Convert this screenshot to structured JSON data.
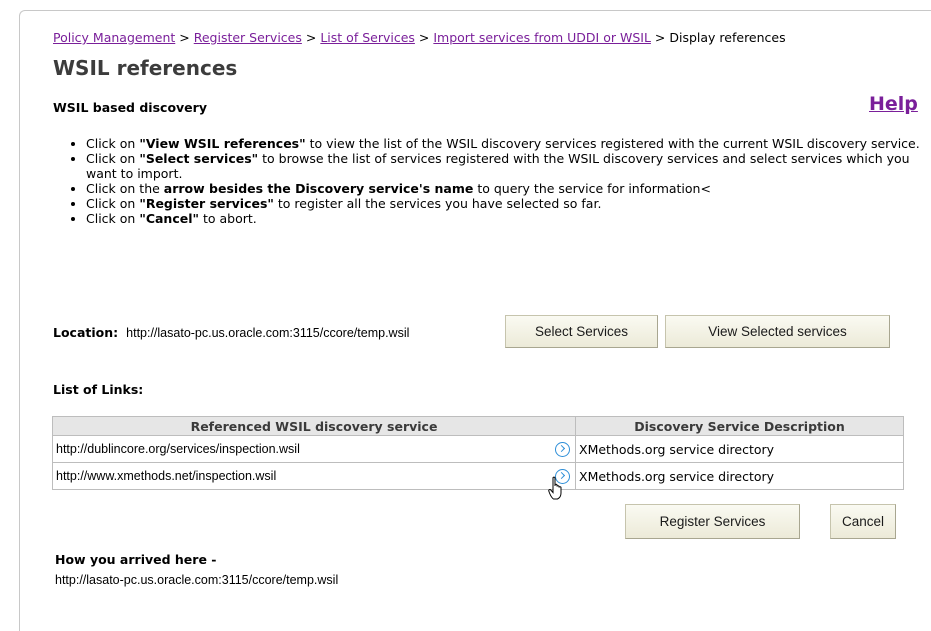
{
  "breadcrumb": {
    "items": [
      "Policy Management",
      "Register Services",
      "List of Services",
      " Import services from UDDI or WSIL"
    ],
    "current": "Display references",
    "separator": ">"
  },
  "page": {
    "title": "WSIL references",
    "subtitle": "WSIL based discovery",
    "help_label": "Help"
  },
  "instructions": [
    {
      "pre": "Click on ",
      "bold": "\"View WSIL references\"",
      "post": " to view the list of the WSIL discovery services registered with the current WSIL discovery service."
    },
    {
      "pre": "Click on ",
      "bold": "\"Select services\"",
      "post": " to browse the list of services registered with the WSIL discovery services and select services which you want to import."
    },
    {
      "pre": "Click on the ",
      "bold": "arrow besides the Discovery service's name",
      "post": " to query the service for information<"
    },
    {
      "pre": "Click on ",
      "bold": "\"Register services\"",
      "post": " to register all the services you have selected so far."
    },
    {
      "pre": "Click on ",
      "bold": "\"Cancel\"",
      "post": " to abort."
    }
  ],
  "location": {
    "label": "Location:",
    "value": "http://lasato-pc.us.oracle.com:3115/ccore/temp.wsil"
  },
  "buttons": {
    "select_services": "Select Services",
    "view_selected": "View Selected services",
    "register_services": "Register Services",
    "cancel": "Cancel"
  },
  "links": {
    "label": "List of Links:",
    "columns": [
      "Referenced WSIL discovery service",
      "Discovery Service Description"
    ],
    "rows": [
      {
        "url": "http://dublincore.org/services/inspection.wsil",
        "description": "XMethods.org service directory"
      },
      {
        "url": "http://www.xmethods.net/inspection.wsil",
        "description": "XMethods.org service directory"
      }
    ]
  },
  "arrived": {
    "label": "How you arrived here -",
    "value": "http://lasato-pc.us.oracle.com:3115/ccore/temp.wsil"
  },
  "colors": {
    "link": "#7a1f9a",
    "arrow_icon": "#2f8fd8",
    "table_header_bg": "#e6e6e6"
  }
}
